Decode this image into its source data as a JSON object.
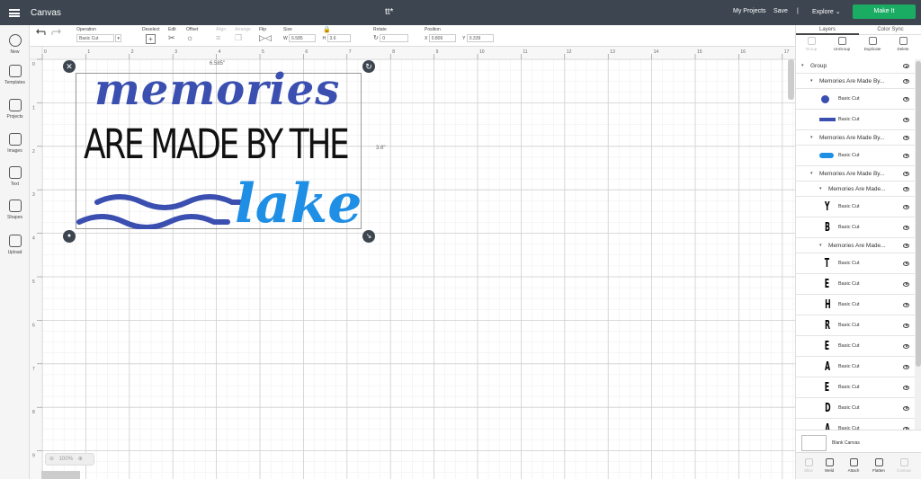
{
  "topbar": {
    "app_name": "Canvas",
    "doc_title": "tt*",
    "my_projects": "My Projects",
    "save": "Save",
    "separator": "|",
    "explore": "Explore",
    "make_it": "Make It"
  },
  "toolbar": {
    "operation_label": "Operation",
    "operation_value": "Basic Cut",
    "deselect_label": "Deselect",
    "edit_label": "Edit",
    "offset_label": "Offset",
    "align_label": "Align",
    "arrange_label": "Arrange",
    "flip_label": "Flip",
    "size_label": "Size",
    "w_label": "W",
    "w_value": "6.585",
    "h_label": "H",
    "h_value": "3.6",
    "rotate_label": "Rotate",
    "rotate_value": "0",
    "position_label": "Position",
    "x_label": "X",
    "x_value": "0.806",
    "y_label": "Y",
    "y_value": "0.339"
  },
  "leftbar": [
    {
      "label": "New",
      "icon": "plus-icon"
    },
    {
      "label": "Templates",
      "icon": "shirt-icon"
    },
    {
      "label": "Projects",
      "icon": "projects-icon"
    },
    {
      "label": "Images",
      "icon": "image-icon"
    },
    {
      "label": "Text",
      "icon": "text-icon"
    },
    {
      "label": "Shapes",
      "icon": "shapes-icon"
    },
    {
      "label": "Upload",
      "icon": "upload-icon"
    }
  ],
  "ruler": {
    "top": [
      "0",
      "1",
      "2",
      "3",
      "4",
      "5",
      "6",
      "7",
      "8",
      "9",
      "10",
      "11",
      "12",
      "13",
      "14",
      "15",
      "16",
      "17"
    ],
    "left": [
      "0",
      "1",
      "2",
      "3",
      "4",
      "5",
      "6",
      "7",
      "8",
      "9"
    ]
  },
  "canvas": {
    "dim_w": "6.585\"",
    "dim_h": "3.6\"",
    "line1": "memories",
    "line2": "ARE MADE BY THE",
    "line3": "lake",
    "zoom": "100%",
    "colors": {
      "blue_dark": "#3a4fb0",
      "blue_light": "#1f8fe6",
      "black": "#111111"
    }
  },
  "rpanel": {
    "tabs": [
      "Layers",
      "Color Sync"
    ],
    "actions": [
      {
        "label": "Group",
        "disabled": true
      },
      {
        "label": "UnGroup",
        "disabled": false
      },
      {
        "label": "Duplicate",
        "disabled": false
      },
      {
        "label": "Delete",
        "disabled": false
      }
    ],
    "layers": [
      {
        "t": "group",
        "text": "Group"
      },
      {
        "t": "sub",
        "text": "Memories Are Made By..."
      },
      {
        "t": "item",
        "text": "Basic Cut",
        "thumb": "dot"
      },
      {
        "t": "item",
        "text": "Basic Cut",
        "thumb": "small"
      },
      {
        "t": "sub",
        "text": "Memories Are Made By..."
      },
      {
        "t": "item",
        "text": "Basic Cut",
        "thumb": "lake"
      },
      {
        "t": "sub",
        "text": "Memories Are Made By..."
      },
      {
        "t": "sub2",
        "text": "Memories Are Made..."
      },
      {
        "t": "item",
        "text": "Basic Cut",
        "thumb": "Y"
      },
      {
        "t": "item",
        "text": "Basic Cut",
        "thumb": "B"
      },
      {
        "t": "sub2",
        "text": "Memories Are Made..."
      },
      {
        "t": "item",
        "text": "Basic Cut",
        "thumb": "T"
      },
      {
        "t": "item",
        "text": "Basic Cut",
        "thumb": "E"
      },
      {
        "t": "item",
        "text": "Basic Cut",
        "thumb": "H"
      },
      {
        "t": "item",
        "text": "Basic Cut",
        "thumb": "R"
      },
      {
        "t": "item",
        "text": "Basic Cut",
        "thumb": "E"
      },
      {
        "t": "item",
        "text": "Basic Cut",
        "thumb": "A"
      },
      {
        "t": "item",
        "text": "Basic Cut",
        "thumb": "E"
      },
      {
        "t": "item",
        "text": "Basic Cut",
        "thumb": "D"
      },
      {
        "t": "item",
        "text": "Basic Cut",
        "thumb": "A"
      }
    ],
    "blank_canvas": "Blank Canvas",
    "bottom": [
      {
        "label": "Slice",
        "disabled": true
      },
      {
        "label": "Weld",
        "disabled": false
      },
      {
        "label": "Attach",
        "disabled": false
      },
      {
        "label": "Flatten",
        "disabled": false
      },
      {
        "label": "Contour",
        "disabled": true
      }
    ]
  }
}
